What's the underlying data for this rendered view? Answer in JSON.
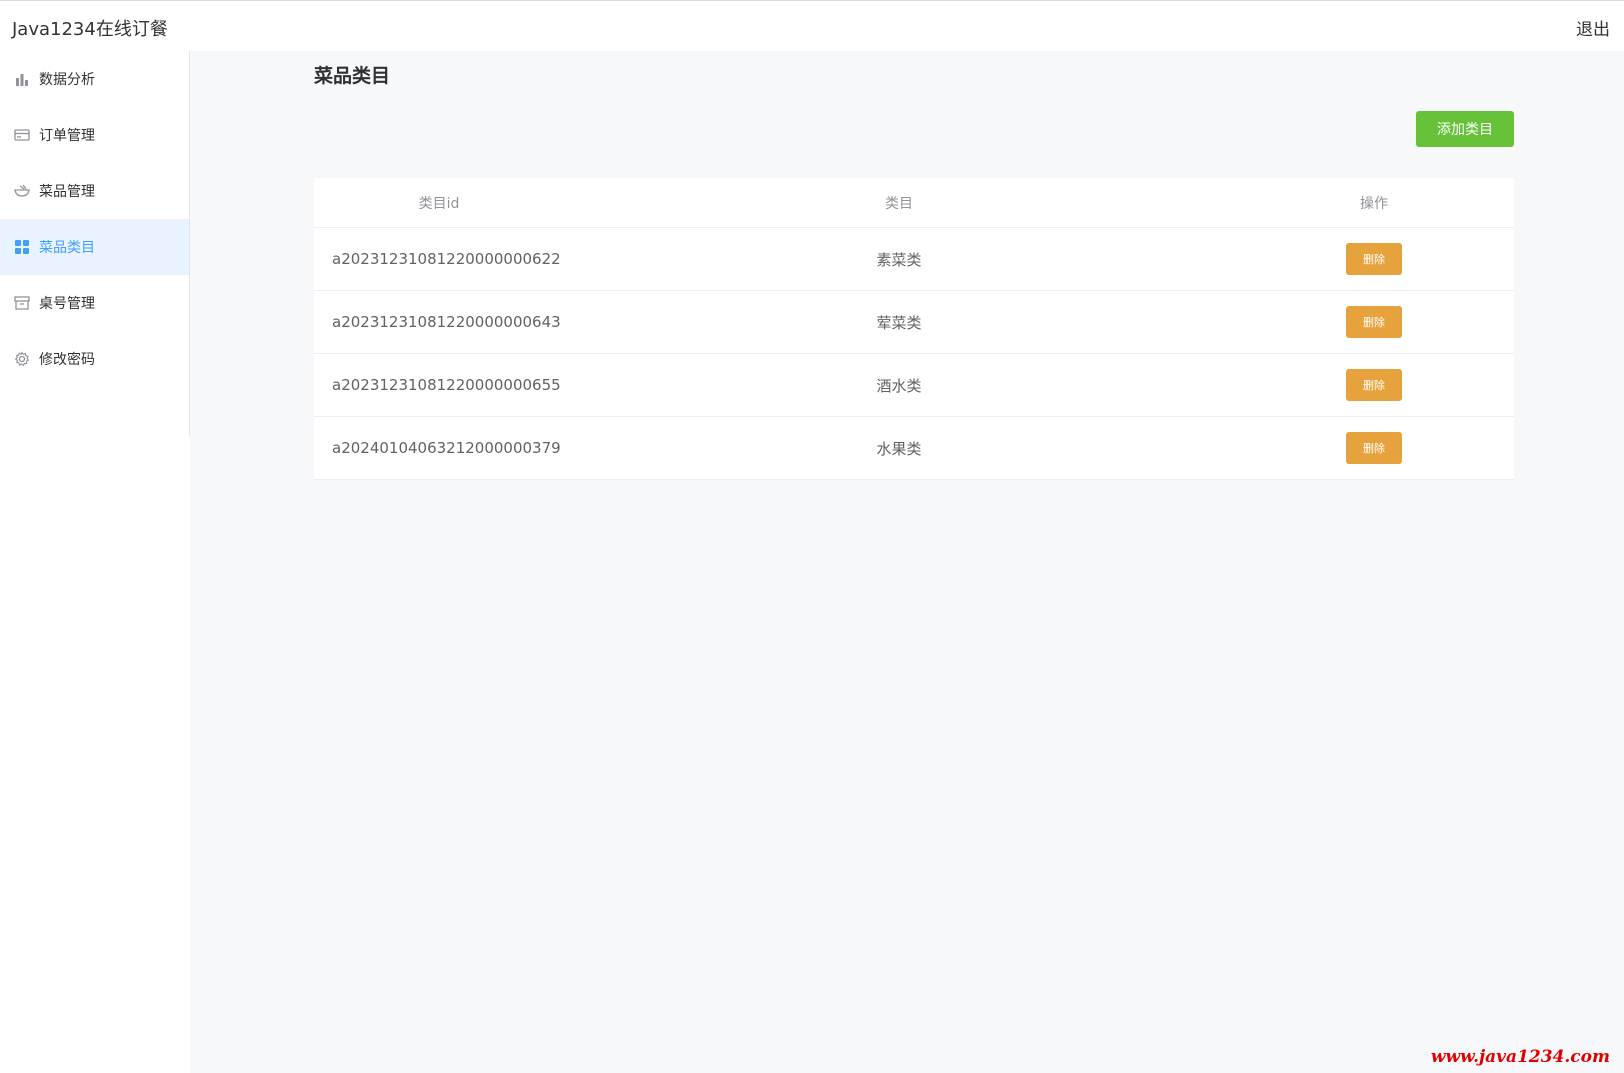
{
  "header": {
    "app_title": "Java1234在线订餐",
    "logout_label": "退出"
  },
  "sidebar": {
    "items": [
      {
        "label": "数据分析",
        "icon": "bar-chart-icon"
      },
      {
        "label": "订单管理",
        "icon": "card-icon"
      },
      {
        "label": "菜品管理",
        "icon": "bowl-icon"
      },
      {
        "label": "菜品类目",
        "icon": "grid-icon",
        "active": true
      },
      {
        "label": "桌号管理",
        "icon": "box-icon"
      },
      {
        "label": "修改密码",
        "icon": "gear-icon"
      }
    ]
  },
  "main": {
    "title": "菜品类目",
    "add_button_label": "添加类目",
    "table": {
      "headers": [
        "类目id",
        "类目",
        "操作"
      ],
      "rows": [
        {
          "id": "a20231231081220000000622",
          "name": "素菜类",
          "action": "删除"
        },
        {
          "id": "a20231231081220000000643",
          "name": "荤菜类",
          "action": "删除"
        },
        {
          "id": "a20231231081220000000655",
          "name": "酒水类",
          "action": "删除"
        },
        {
          "id": "a20240104063212000000379",
          "name": "水果类",
          "action": "删除"
        }
      ]
    }
  },
  "watermark": "www.java1234.com",
  "colors": {
    "primary": "#409eff",
    "success": "#67c23a",
    "warning": "#e6a23c",
    "watermark": "#e00000"
  }
}
